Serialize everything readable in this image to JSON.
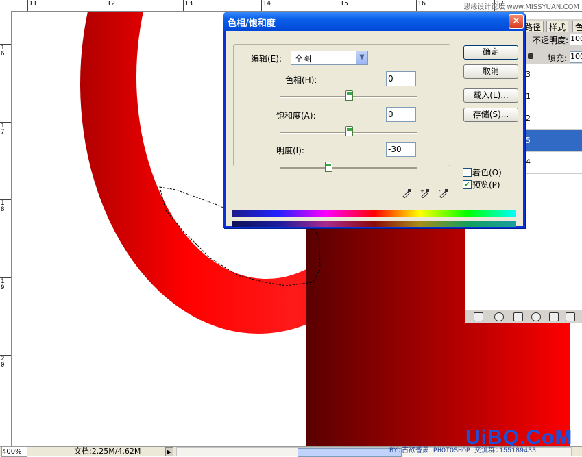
{
  "ruler": {
    "top_labels": [
      "11",
      "12",
      "13",
      "14",
      "15",
      "16",
      "17"
    ],
    "left_labels": [
      "1\n6",
      "1\n7",
      "1\n8",
      "1\n9",
      "2\n0"
    ],
    "watermark": "思缘设计论坛 www.MISSYUAN.COM"
  },
  "layers_panel": {
    "tabs": [
      "路径",
      "样式",
      "色"
    ],
    "opacity_label": "不透明度:",
    "opacity_value": "100",
    "fill_label": "填充:",
    "fill_value": "100",
    "layer_numbers": [
      "3",
      "1",
      "2",
      "5",
      "4"
    ]
  },
  "dialog": {
    "title": "色相/饱和度",
    "close_label": "✕",
    "edit_label": "编辑(E):",
    "edit_value": "全图",
    "hue_label": "色相(H):",
    "hue_value": "0",
    "saturation_label": "饱和度(A):",
    "saturation_value": "0",
    "lightness_label": "明度(I):",
    "lightness_value": "-30",
    "ok_label": "确定",
    "cancel_label": "取消",
    "load_label": "载入(L)...",
    "save_label": "存储(S)...",
    "colorize_label": "着色(O)",
    "colorize_checked": false,
    "preview_label": "预览(P)",
    "preview_checked": true
  },
  "status_bar": {
    "zoom": "400%",
    "doc_info": "文档:2.25M/4.62M",
    "credit": "BY:古欲香萧  PHOTOSHOP 交流群:155189433"
  },
  "logo": "UiBQ.CoM",
  "colors": {
    "dialog_title": "#0a5fe8",
    "selected_layer": "#316ac5",
    "red": "#ff0000"
  }
}
